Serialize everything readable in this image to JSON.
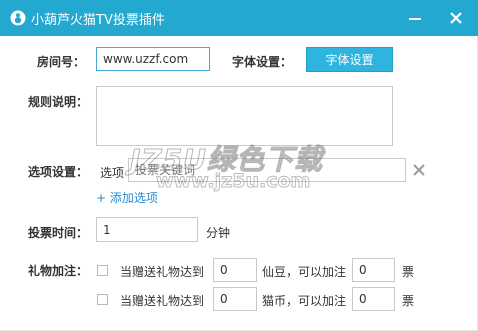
{
  "window": {
    "title": "小葫芦火猫TV投票插件",
    "minimize_glyph": "—",
    "close_glyph": "X"
  },
  "room": {
    "label": "房间号：",
    "value": "www.uzzf.com"
  },
  "font_settings": {
    "label": "字体设置：",
    "button_label": "字体设置"
  },
  "rules": {
    "label": "规则说明：",
    "value": ""
  },
  "options": {
    "label": "选项设置：",
    "option_prefix": "选项",
    "keyword_placeholder": "投票关键词",
    "add_link": "+ 添加选项"
  },
  "vote_time": {
    "label": "投票时间：",
    "value": "1",
    "unit": "分钟"
  },
  "gift_bonus": {
    "label": "礼物加注：",
    "rows": [
      {
        "prefix": "当赠送礼物达到",
        "amount": "0",
        "middle": "仙豆，可以加注",
        "votes": "0",
        "suffix": "票"
      },
      {
        "prefix": "当赠送礼物达到",
        "amount": "0",
        "middle": "猫币，可以加注",
        "votes": "0",
        "suffix": "票"
      }
    ]
  },
  "watermark": {
    "main": "JZ5U绿色下载",
    "sub": "www.jz5u.com"
  },
  "colors": {
    "titlebar": "#23a8cf",
    "primary_button": "#2fb4df",
    "link": "#2a8cd0"
  },
  "icons": {
    "app": "gourd-logo-icon",
    "minimize": "minimize-icon",
    "close": "close-icon",
    "remove_option": "remove-x-icon"
  }
}
